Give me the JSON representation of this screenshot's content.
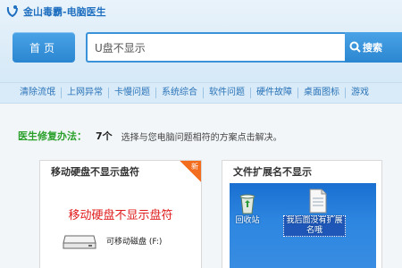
{
  "header": {
    "site_title": "金山毒霸-电脑医生",
    "home_label": "首页",
    "search_value": "U盘不显示",
    "search_button_label": "搜索"
  },
  "nav": {
    "items": [
      "清除流氓",
      "上网异常",
      "卡慢问题",
      "系统综合",
      "软件问题",
      "硬件故障",
      "桌面图标",
      "游戏"
    ]
  },
  "fix": {
    "label": "医生修复办法：",
    "count": "7个",
    "description": "选择与您电脑问题相符的方案点击解决。"
  },
  "cards": [
    {
      "title": "移动硬盘不显示盘符",
      "badge": "新",
      "image_caption": "移动硬盘不显示盘符",
      "drive_label": "可移动磁盘 (F:)"
    },
    {
      "title": "文件扩展名不显示",
      "desktop_icons": [
        {
          "label": "回收站",
          "icon": "recycle-bin-icon"
        },
        {
          "label": "我后面没有扩展名哦",
          "icon": "document-icon"
        }
      ]
    }
  ],
  "colors": {
    "accent_blue": "#2b86d1",
    "fix_green": "#2aa02a",
    "caption_red": "#e01c1c",
    "badge_orange": "#f36d1f"
  }
}
